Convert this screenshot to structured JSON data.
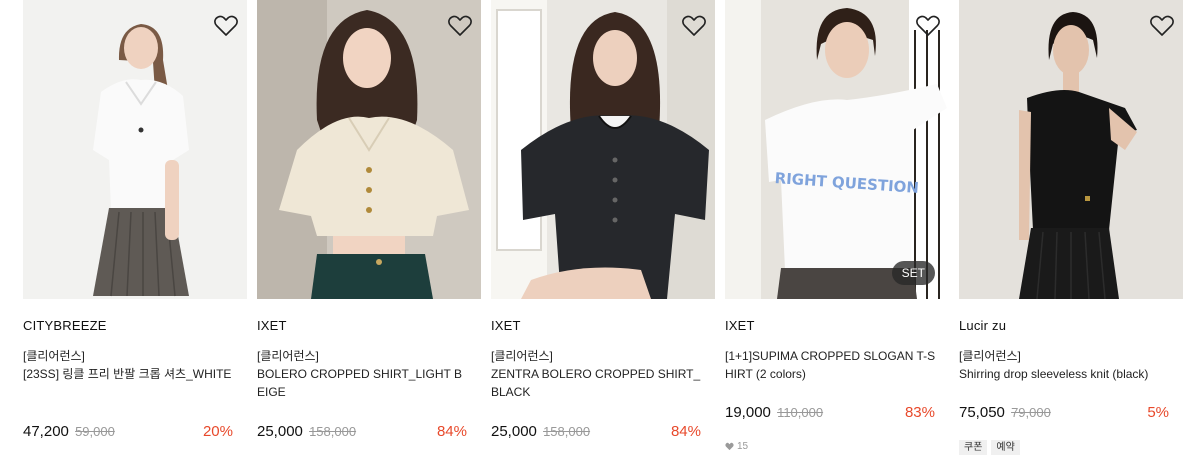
{
  "products": [
    {
      "brand": "CITYBREEZE",
      "tag": "[클리어런스]",
      "title": "[23SS] 링클 프리 반팔 크롭 셔츠_WHITE",
      "price": "47,200",
      "original_price": "59,000",
      "discount": "20%"
    },
    {
      "brand": "IXET",
      "tag": "[클리어런스]",
      "title": "BOLERO CROPPED SHIRT_LIGHT BEIGE",
      "price": "25,000",
      "original_price": "158,000",
      "discount": "84%"
    },
    {
      "brand": "IXET",
      "tag": "[클리어런스]",
      "title": "ZENTRA BOLERO CROPPED SHIRT_BLACK",
      "price": "25,000",
      "original_price": "158,000",
      "discount": "84%"
    },
    {
      "brand": "IXET",
      "title": "[1+1]SUPIMA CROPPED SLOGAN T-SHIRT (2 colors)",
      "price": "19,000",
      "original_price": "110,000",
      "discount": "83%",
      "badge": "SET",
      "likes": "15",
      "slogan": "RIGHT QUESTION"
    },
    {
      "brand": "Lucir zu",
      "tag": "[클리어런스]",
      "title": "Shirring drop sleeveless knit (black)",
      "price": "75,050",
      "original_price": "79,000",
      "discount": "5%",
      "chips": [
        "쿠폰",
        "예약"
      ]
    }
  ],
  "icons": {
    "wishlist": "heart-outline-icon",
    "likes": "heart-filled-icon"
  },
  "colors": {
    "discount": "#e8492b",
    "original_price": "#999999",
    "badge_bg": "#282828"
  }
}
